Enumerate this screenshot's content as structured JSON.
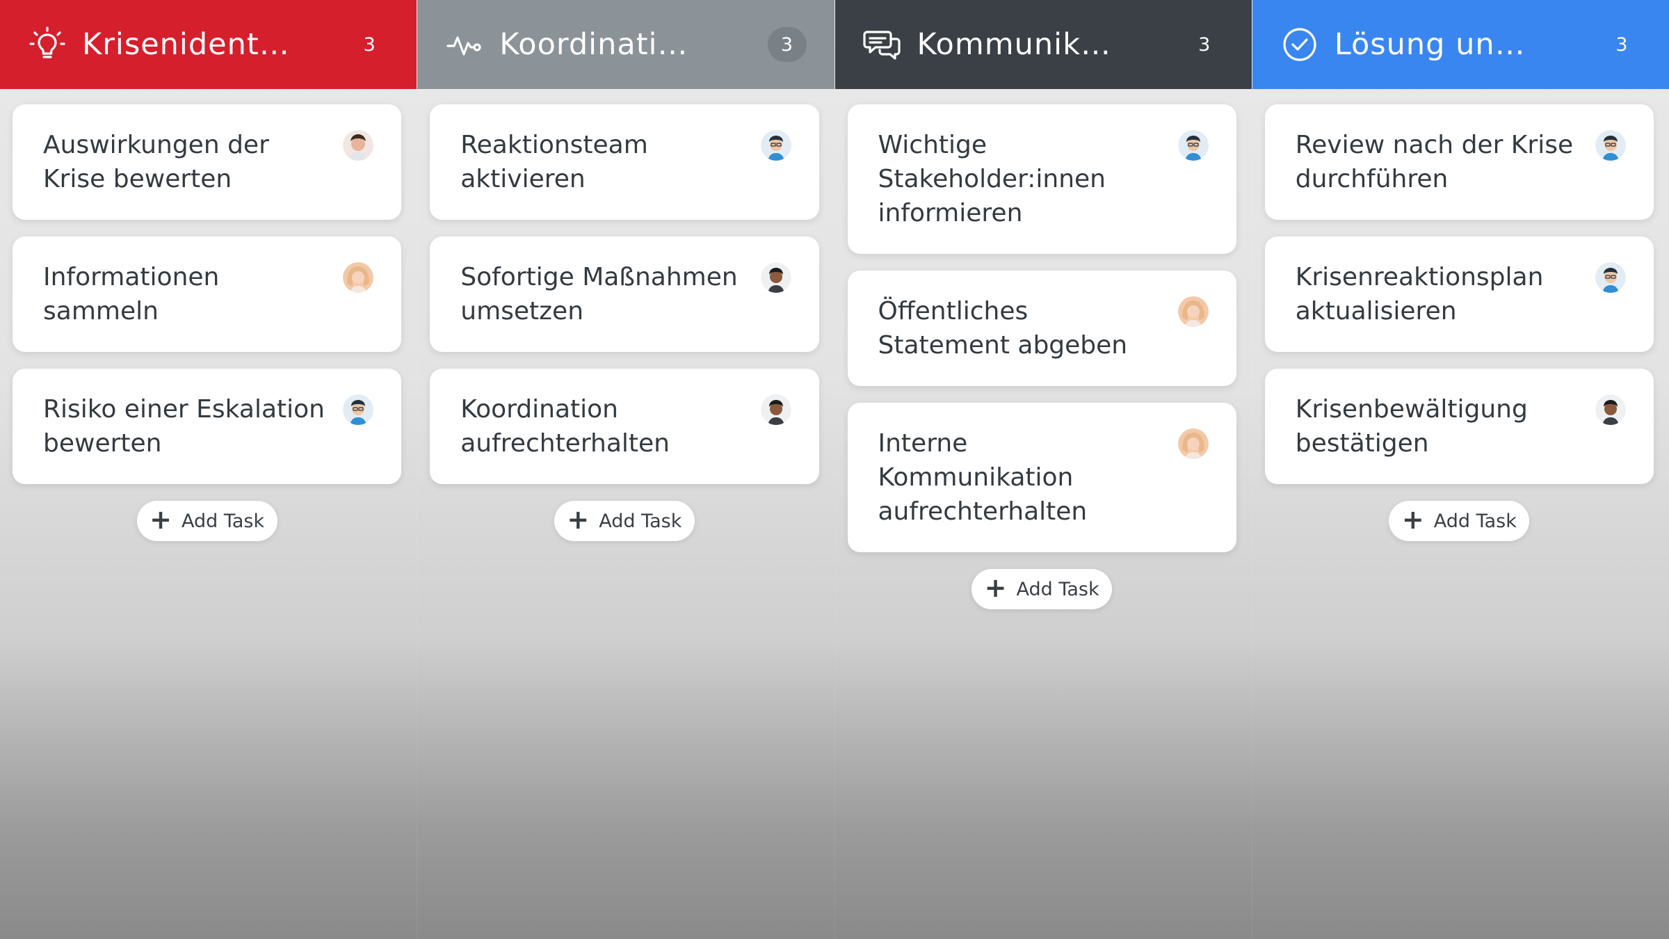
{
  "columns": [
    {
      "title": "Krisenident…",
      "count": "3",
      "header_color": "#d61f2c",
      "count_bg": "transparent",
      "icon": "lightbulb-icon",
      "add_label": "Add Task",
      "cards": [
        {
          "title": "Auswirkungen der Krise bewerten",
          "avatar": "man-short-hair"
        },
        {
          "title": "Informationen sammeln",
          "avatar": "woman-blonde"
        },
        {
          "title": "Risiko einer Eskalation bewerten",
          "avatar": "man-cartoon"
        }
      ]
    },
    {
      "title": "Koordinati…",
      "count": "3",
      "header_color": "#8b9398",
      "count_bg": "#7a8186",
      "icon": "pulse-icon",
      "add_label": "Add Task",
      "cards": [
        {
          "title": "Reaktionsteam aktivieren",
          "avatar": "man-cartoon"
        },
        {
          "title": "Sofortige Maßnahmen umsetzen",
          "avatar": "man-cartoon-dark"
        },
        {
          "title": "Koordination aufrechterhalten",
          "avatar": "man-cartoon-dark"
        }
      ]
    },
    {
      "title": "Kommunik…",
      "count": "3",
      "header_color": "#3a4046",
      "count_bg": "transparent",
      "icon": "chat-bubbles-icon",
      "add_label": "Add Task",
      "cards": [
        {
          "title": "Wichtige Stakeholder:innen informieren",
          "avatar": "man-cartoon"
        },
        {
          "title": "Öffentliches Statement abgeben",
          "avatar": "woman-blonde"
        },
        {
          "title": "Interne Kommunikation aufrechterhalten",
          "avatar": "woman-blonde"
        }
      ]
    },
    {
      "title": "Lösung un…",
      "count": "3",
      "header_color": "#3a86f0",
      "count_bg": "transparent",
      "icon": "check-circle-icon",
      "add_label": "Add Task",
      "cards": [
        {
          "title": "Review nach der Krise durchführen",
          "avatar": "man-cartoon"
        },
        {
          "title": "Krisenreaktionsplan aktualisieren",
          "avatar": "man-cartoon"
        },
        {
          "title": "Krisenbewältigung bestätigen",
          "avatar": "man-cartoon-dark"
        }
      ]
    }
  ]
}
